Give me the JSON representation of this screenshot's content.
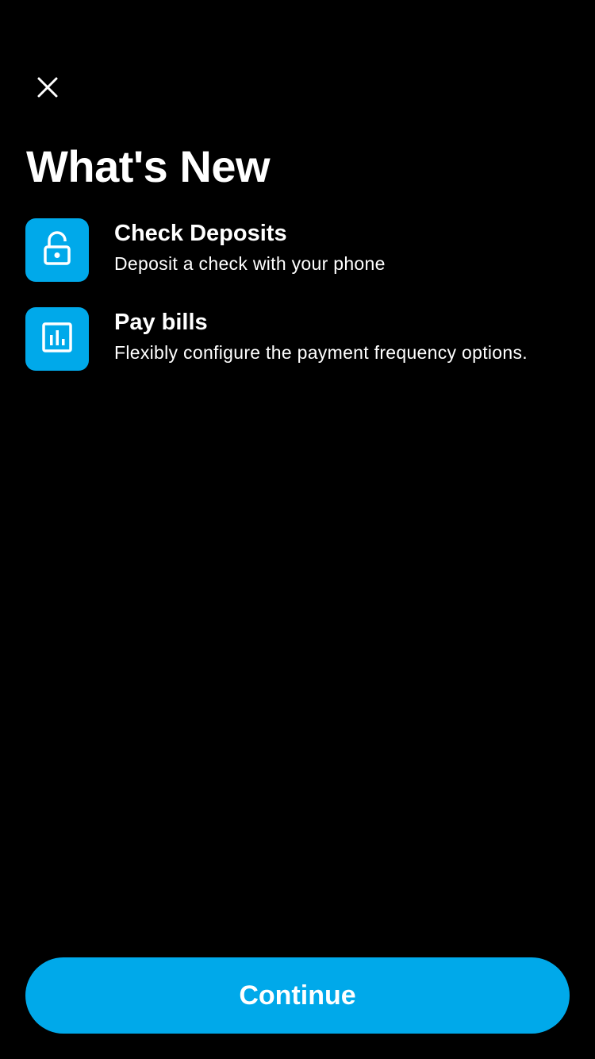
{
  "header": {
    "close_icon": "close-icon",
    "title": "What's New"
  },
  "features": [
    {
      "icon": "lock-open-icon",
      "title": "Check Deposits",
      "description": "Deposit a check with your phone"
    },
    {
      "icon": "bar-chart-icon",
      "title": "Pay bills",
      "description": "Flexibly configure the payment frequency options."
    }
  ],
  "footer": {
    "continue_label": "Continue"
  },
  "colors": {
    "background": "#000000",
    "accent": "#00a9ea",
    "text": "#ffffff"
  }
}
